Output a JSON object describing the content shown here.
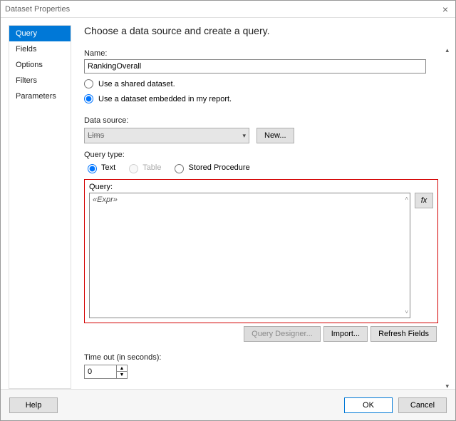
{
  "titlebar": {
    "title": "Dataset Properties"
  },
  "sidebar": {
    "items": [
      {
        "label": "Query",
        "active": true
      },
      {
        "label": "Fields"
      },
      {
        "label": "Options"
      },
      {
        "label": "Filters"
      },
      {
        "label": "Parameters"
      }
    ]
  },
  "main": {
    "heading": "Choose a data source and create a query.",
    "name_label": "Name:",
    "name_value": "RankingOverall",
    "radio_shared": "Use a shared dataset.",
    "radio_embedded": "Use a dataset embedded in my report.",
    "ds_label": "Data source:",
    "ds_value": "Lims",
    "ds_new": "New...",
    "qtype_label": "Query type:",
    "qtype_options": {
      "text": "Text",
      "table": "Table",
      "sp": "Stored Procedure"
    },
    "query_label": "Query:",
    "query_value": "«Expr»",
    "fx_label": "fx",
    "btn_designer": "Query Designer...",
    "btn_import": "Import...",
    "btn_refresh": "Refresh Fields",
    "timeout_label": "Time out (in seconds):",
    "timeout_value": "0"
  },
  "footer": {
    "help": "Help",
    "ok": "OK",
    "cancel": "Cancel"
  }
}
